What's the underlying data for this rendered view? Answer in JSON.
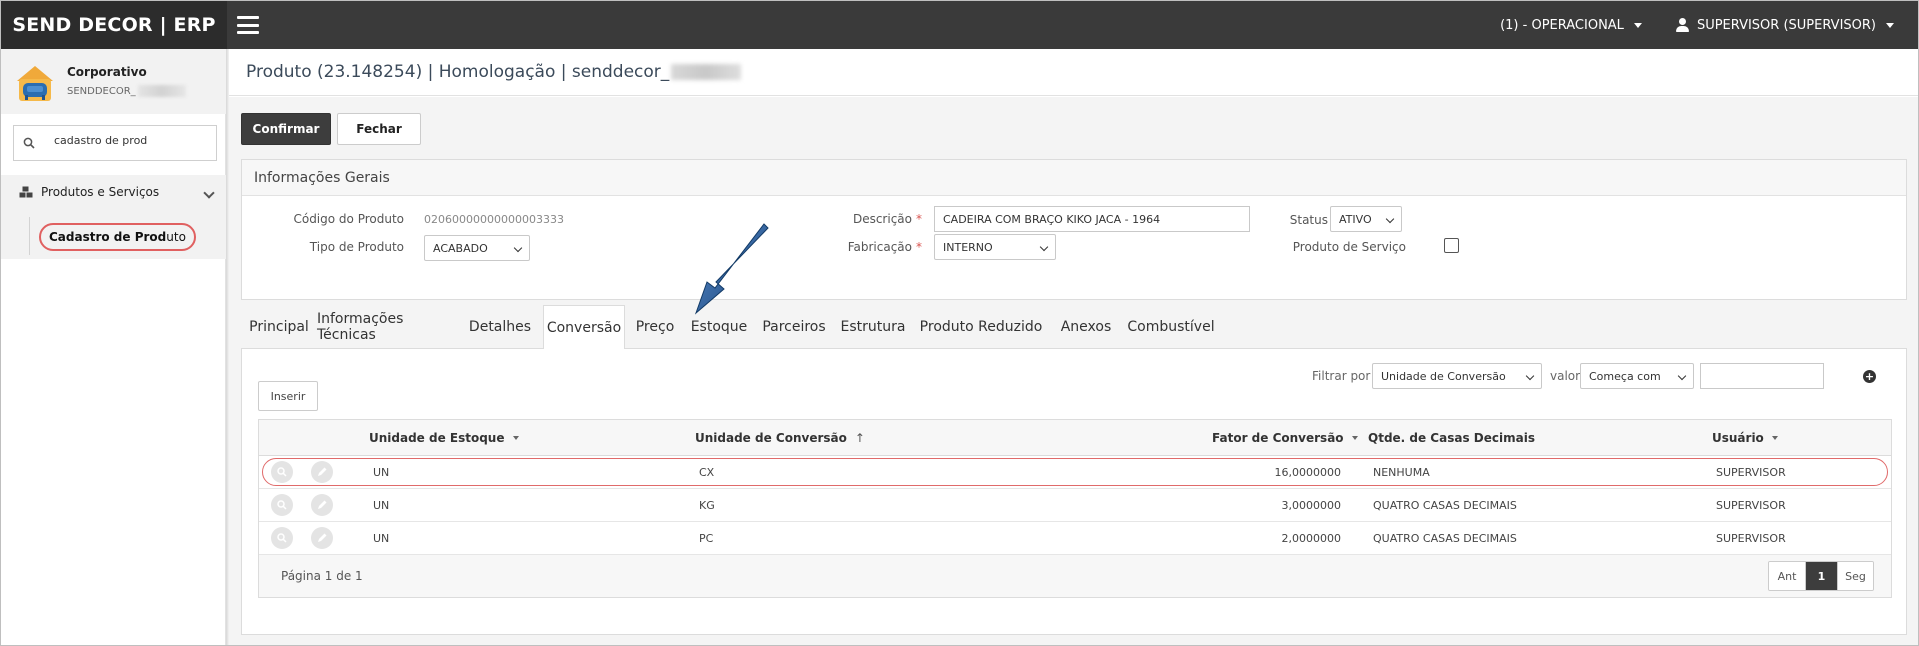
{
  "topbar": {
    "brand": "SEND DECOR | ERP",
    "company": "(1) - OPERACIONAL",
    "user": "SUPERVISOR (SUPERVISOR)"
  },
  "sidebar": {
    "profile_name": "Corporativo",
    "profile_sub": "SENDDECOR_",
    "search_value": "cadastro de prod",
    "group_label": "Produtos e Serviços",
    "item_bold": "Cadastro de Prod",
    "item_rest": "uto"
  },
  "page": {
    "title": "Produto (23.148254) | Homologação | senddecor_",
    "confirm_label": "Confirmar",
    "close_label": "Fechar"
  },
  "general": {
    "heading": "Informações Gerais",
    "code_label": "Código do Produto",
    "code_value": "02060000000000003333",
    "type_label": "Tipo de Produto",
    "type_value": "ACABADO",
    "desc_label": "Descrição",
    "desc_value": "CADEIRA COM BRAÇO KIKO JACA - 1964",
    "fab_label": "Fabricação",
    "fab_value": "INTERNO",
    "status_label": "Status",
    "status_value": "ATIVO",
    "service_label": "Produto de Serviço"
  },
  "tabs": [
    "Principal",
    "Informações Técnicas",
    "Detalhes",
    "Conversão",
    "Preço",
    "Estoque",
    "Parceiros",
    "Estrutura",
    "Produto Reduzido",
    "Anexos",
    "Combustível"
  ],
  "active_tab": "Conversão",
  "conversion": {
    "insert_label": "Inserir",
    "filter_label": "Filtrar por",
    "filter_field": "Unidade de Conversão",
    "value_label": "valor",
    "filter_op": "Começa com",
    "filter_value": "",
    "columns": [
      "Unidade de Estoque",
      "Unidade de Conversão",
      "Fator de Conversão",
      "Qtde. de Casas Decimais",
      "Usuário"
    ],
    "rows": [
      {
        "stock_unit": "UN",
        "conv_unit": "CX",
        "factor": "16,0000000",
        "decimals": "NENHUMA",
        "user": "SUPERVISOR"
      },
      {
        "stock_unit": "UN",
        "conv_unit": "KG",
        "factor": "3,0000000",
        "decimals": "QUATRO CASAS DECIMAIS",
        "user": "SUPERVISOR"
      },
      {
        "stock_unit": "UN",
        "conv_unit": "PC",
        "factor": "2,0000000",
        "decimals": "QUATRO CASAS DECIMAIS",
        "user": "SUPERVISOR"
      }
    ],
    "page_info": "Página 1 de 1",
    "prev_label": "Ant",
    "current_page": "1",
    "next_label": "Seg"
  },
  "colors": {
    "topbar": "#3a3a3a",
    "highlight": "#e06060",
    "arrow": "#1b4f8a"
  }
}
